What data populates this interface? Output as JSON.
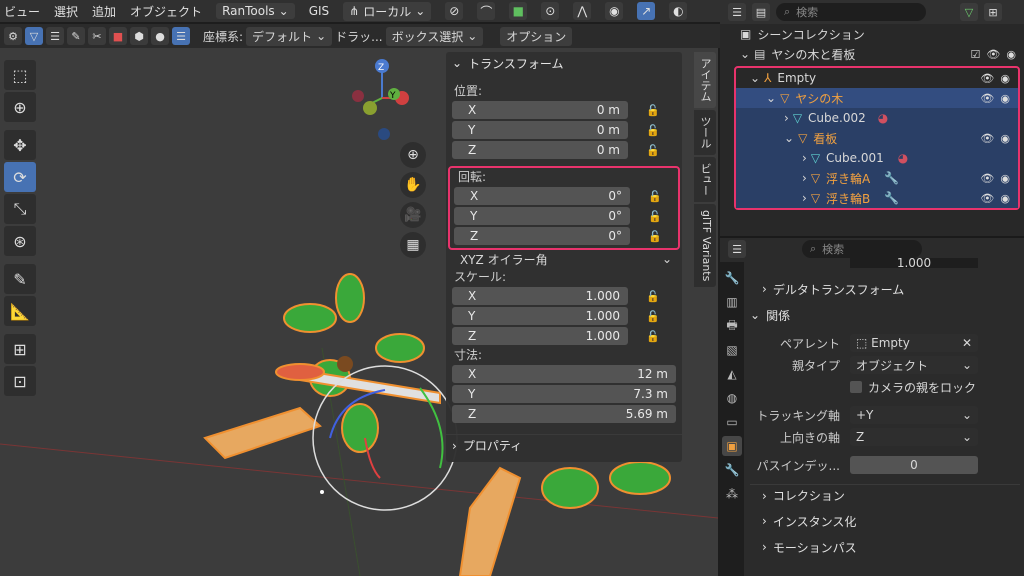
{
  "menubar": {
    "items": [
      "ビュー",
      "選択",
      "追加",
      "オブジェクト"
    ],
    "rantools": "RanTools",
    "gis": "GIS",
    "orientation": "ローカル"
  },
  "toolbar2": {
    "coord_label": "座標系:",
    "coord_value": "デフォルト",
    "drag_label": "ドラッ...",
    "select_mode": "ボックス選択",
    "options": "オプション"
  },
  "npanel": {
    "transform_title": "トランスフォーム",
    "location_label": "位置:",
    "location": [
      {
        "axis": "X",
        "value": "0 m"
      },
      {
        "axis": "Y",
        "value": "0 m"
      },
      {
        "axis": "Z",
        "value": "0 m"
      }
    ],
    "rotation_label": "回転:",
    "rotation": [
      {
        "axis": "X",
        "value": "0°"
      },
      {
        "axis": "Y",
        "value": "0°"
      },
      {
        "axis": "Z",
        "value": "0°"
      }
    ],
    "rotation_mode": "XYZ オイラー角",
    "scale_label": "スケール:",
    "scale": [
      {
        "axis": "X",
        "value": "1.000"
      },
      {
        "axis": "Y",
        "value": "1.000"
      },
      {
        "axis": "Z",
        "value": "1.000"
      }
    ],
    "dimensions_label": "寸法:",
    "dimensions": [
      {
        "axis": "X",
        "value": "12 m"
      },
      {
        "axis": "Y",
        "value": "7.3 m"
      },
      {
        "axis": "Z",
        "value": "5.69 m"
      }
    ],
    "properties_title": "プロパティ"
  },
  "vtabs": [
    "アイテム",
    "ツール",
    "ビュー",
    "glTF Variants"
  ],
  "outliner": {
    "search_placeholder": "検索",
    "scene_collection": "シーンコレクション",
    "collection": "ヤシの木と看板",
    "rows": [
      {
        "name": "Empty",
        "indent": 1
      },
      {
        "name": "ヤシの木",
        "indent": 2
      },
      {
        "name": "Cube.002",
        "indent": 3
      },
      {
        "name": "看板",
        "indent": 3
      },
      {
        "name": "Cube.001",
        "indent": 4
      },
      {
        "name": "浮き輪A",
        "indent": 4
      },
      {
        "name": "浮き輪B",
        "indent": 4
      }
    ]
  },
  "properties": {
    "search_placeholder": "検索",
    "top_value": "1.000",
    "delta_transform": "デルタトランスフォーム",
    "relations": "関係",
    "parent_label": "ペアレント",
    "parent_value": "Empty",
    "parent_type_label": "親タイプ",
    "parent_type_value": "オブジェクト",
    "camera_parent": "カメラの親をロック",
    "tracking_axis_label": "トラッキング軸",
    "tracking_axis_value": "+Y",
    "up_axis_label": "上向きの軸",
    "up_axis_value": "Z",
    "pass_index_label": "パスインデッ...",
    "pass_index_value": "0",
    "collections": "コレクション",
    "instancing": "インスタンス化",
    "motion_path": "モーションパス"
  },
  "colors": {
    "accent": "#4772b3",
    "highlight": "#e8336c",
    "object_orange": "#f0a040",
    "selected_row": "#334d80"
  }
}
